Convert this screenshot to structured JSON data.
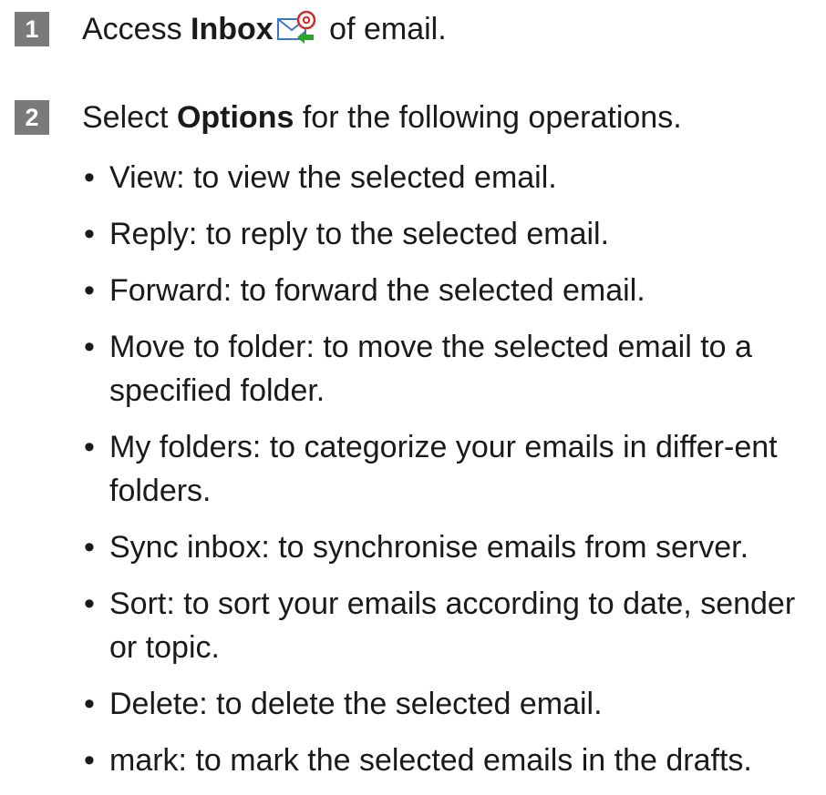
{
  "steps": [
    {
      "number": "1",
      "prefix": "Access ",
      "bold": "Inbox",
      "icon": "inbox-email-icon",
      "suffix": " of email."
    },
    {
      "number": "2",
      "prefix": "Select ",
      "bold": "Options",
      "suffix": " for the following operations."
    }
  ],
  "bullet_symbol": "•",
  "operations": [
    "View: to view the selected email.",
    "Reply: to reply to the selected email.",
    "Forward: to forward the selected email.",
    "Move to folder: to move the selected email to a specified folder.",
    "My folders: to categorize your emails in differ-ent folders.",
    "Sync inbox: to synchronise emails from server.",
    "Sort: to sort your emails according to date, sender or topic.",
    "Delete: to delete the selected email.",
    "mark: to mark the selected emails in the drafts."
  ],
  "colors": {
    "badge": "#7a7a7a",
    "text": "#1a1a1a",
    "icon_envelope": "#3a78c9",
    "icon_at": "#d42a2a",
    "icon_arrow": "#2aa52a"
  }
}
